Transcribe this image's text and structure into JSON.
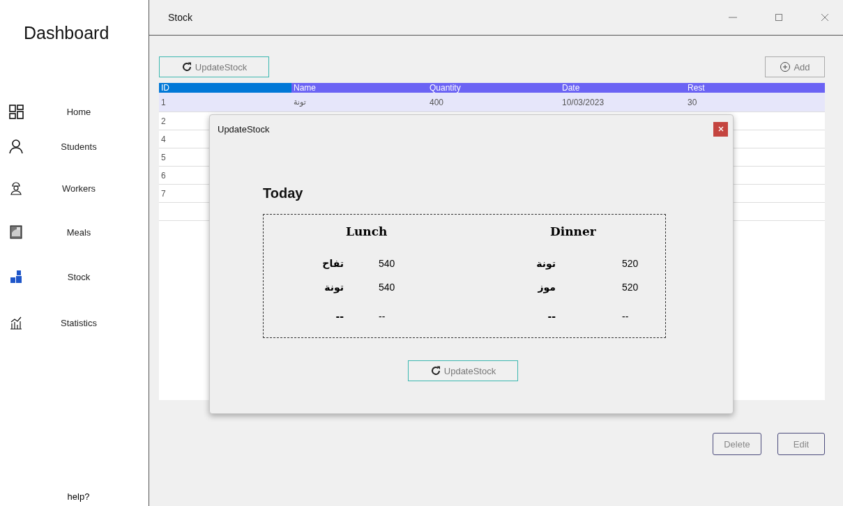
{
  "sidebar": {
    "title": "Dashboard",
    "items": [
      {
        "label": "Home",
        "selected": false
      },
      {
        "label": "Students",
        "selected": false
      },
      {
        "label": "Workers",
        "selected": false
      },
      {
        "label": "Meals",
        "selected": false
      },
      {
        "label": "Stock",
        "selected": true
      },
      {
        "label": "Statistics",
        "selected": false
      }
    ],
    "help": "help?"
  },
  "window": {
    "title": "Stock"
  },
  "toolbar": {
    "update_button": "UpdateStock",
    "add_button": "Add"
  },
  "table": {
    "columns": [
      "ID",
      "Name",
      "Quantity",
      "Date",
      "Rest"
    ],
    "rows": [
      {
        "selected": true,
        "cells": [
          "1",
          "تونة",
          "400",
          "10/03/2023",
          "30"
        ]
      },
      {
        "selected": false,
        "cells": [
          "2"
        ]
      },
      {
        "selected": false,
        "cells": [
          "4"
        ]
      },
      {
        "selected": false,
        "cells": [
          "5"
        ]
      },
      {
        "selected": false,
        "cells": [
          "6"
        ]
      },
      {
        "selected": false,
        "cells": [
          "7"
        ]
      }
    ]
  },
  "dialog": {
    "title": "UpdateStock",
    "heading": "Today",
    "lunch": {
      "name": "Lunch",
      "items": [
        {
          "food": "تفاح",
          "quantity": "540"
        },
        {
          "food": "تونة",
          "quantity": "540"
        },
        {
          "food": "--",
          "quantity": "--"
        }
      ]
    },
    "dinner": {
      "name": "Dinner",
      "items": [
        {
          "food": "تونة",
          "quantity": "520"
        },
        {
          "food": "موز",
          "quantity": "520"
        },
        {
          "food": "--",
          "quantity": "--"
        }
      ]
    },
    "button": "UpdateStock"
  },
  "buttons": [
    "Delete",
    "Edit"
  ]
}
